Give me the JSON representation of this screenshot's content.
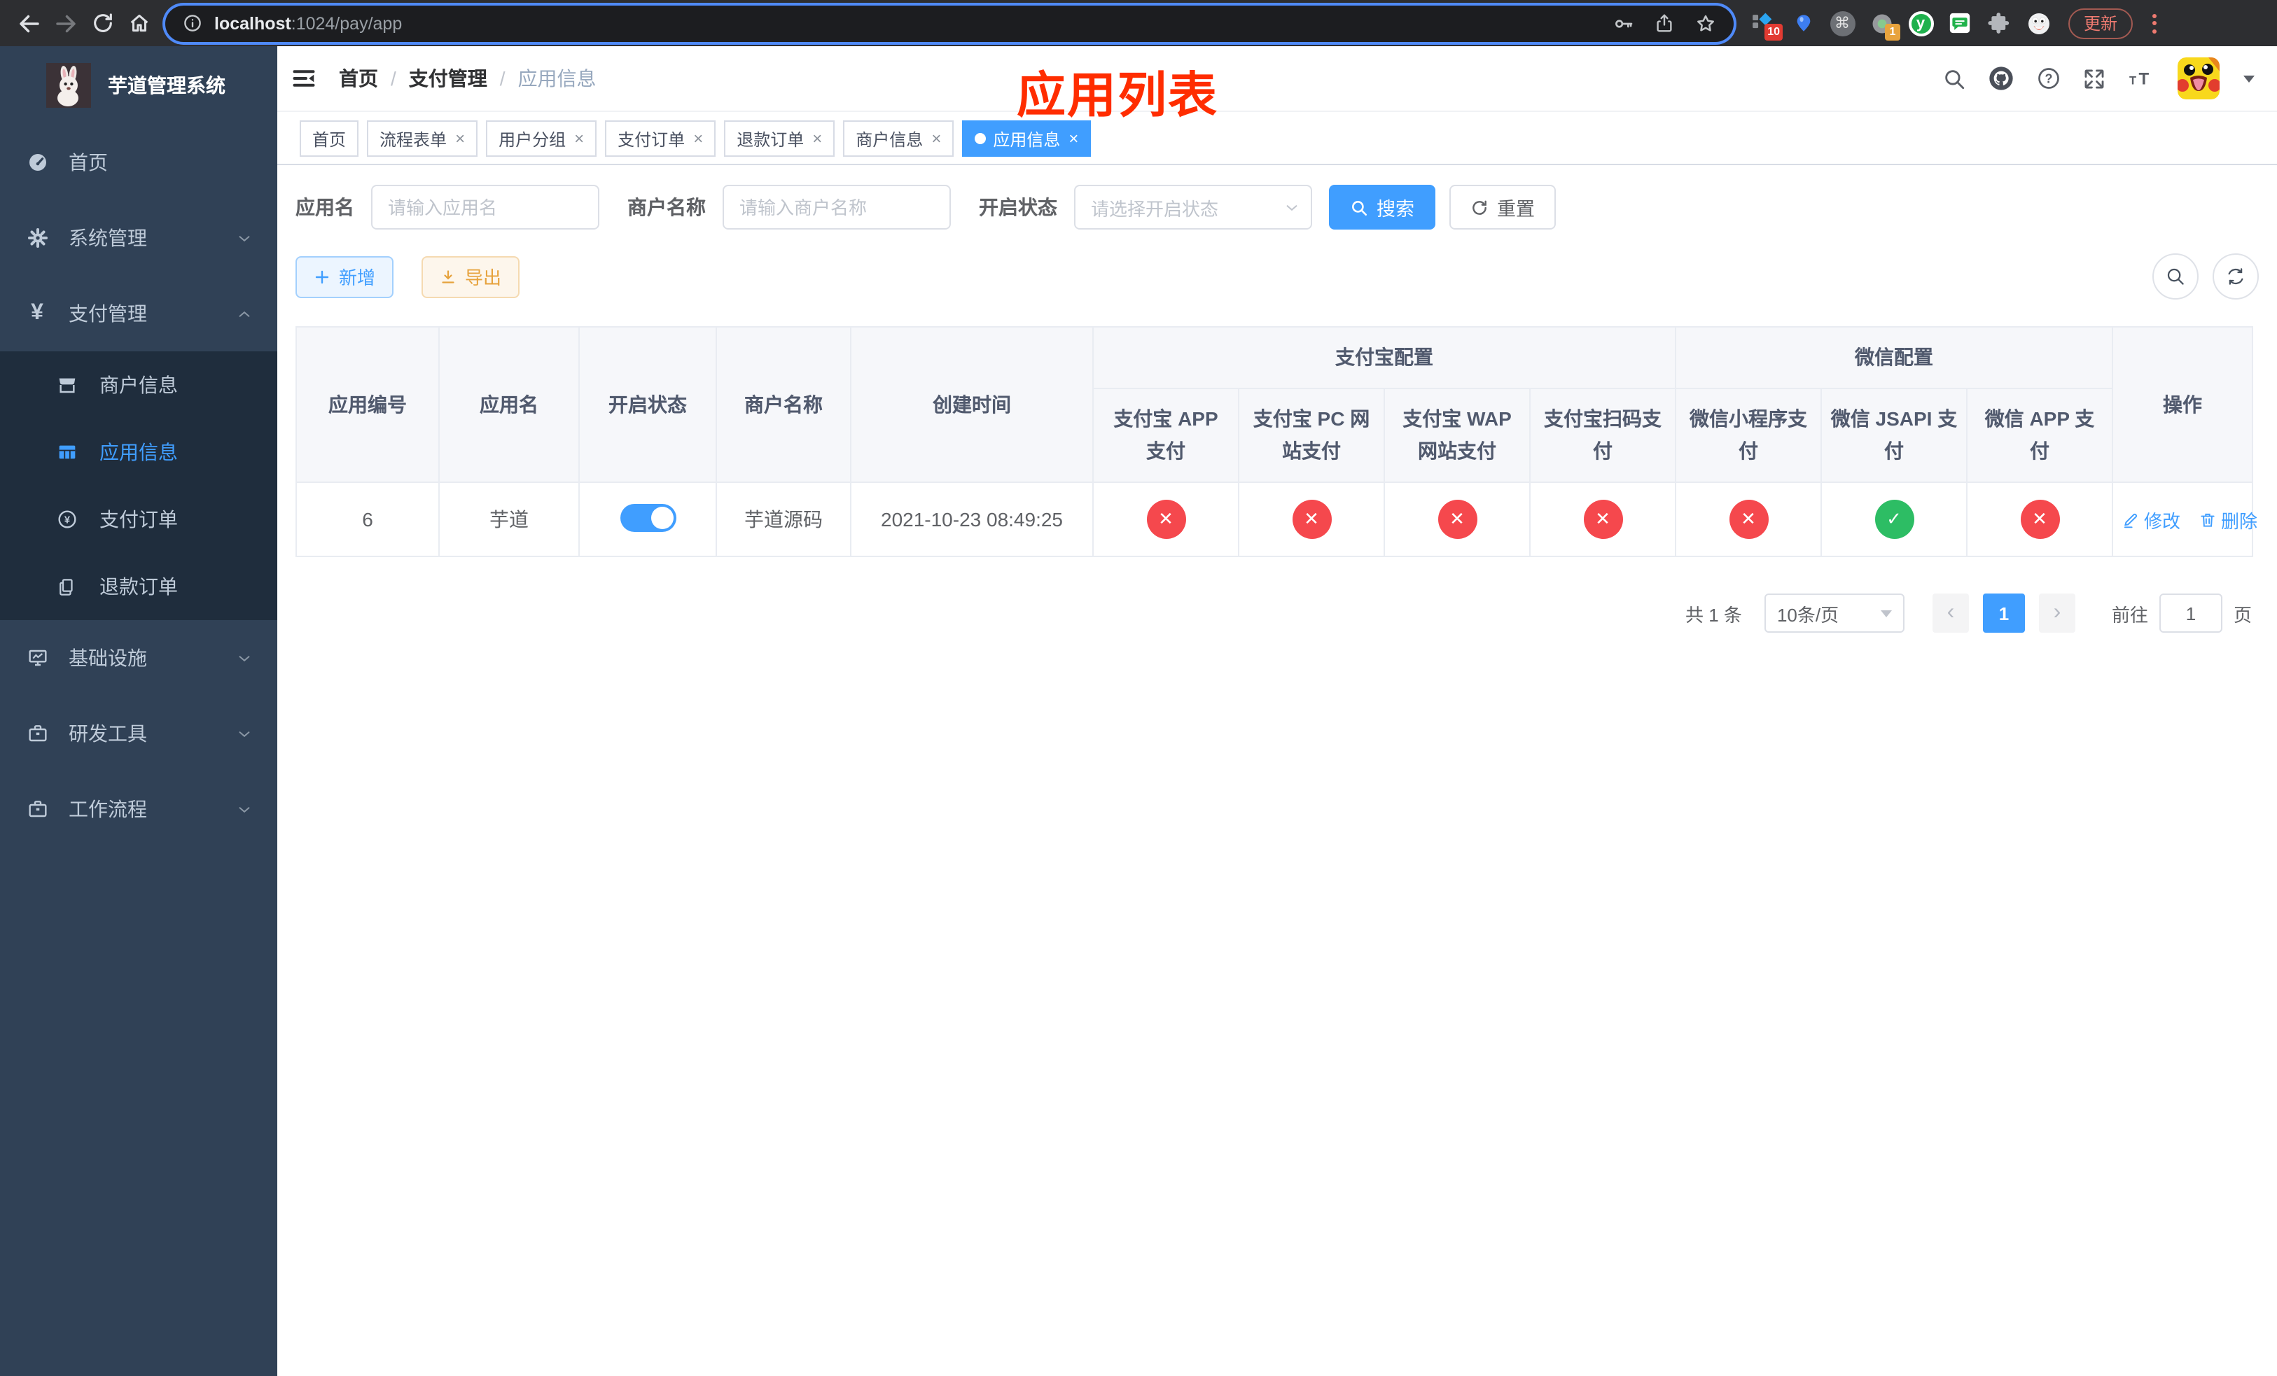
{
  "browser": {
    "url_host": "localhost",
    "url_path": ":1024/pay/app",
    "update_label": "更新",
    "ext_badge_10": "10",
    "ext_badge_1": "1",
    "cmd_glyph": "⌘",
    "y_glyph": "y"
  },
  "sidebar": {
    "logo_title": "芋道管理系统",
    "items": {
      "home": "首页",
      "system": "系统管理",
      "payment": "支付管理",
      "merchant": "商户信息",
      "app": "应用信息",
      "pay_order": "支付订单",
      "refund_order": "退款订单",
      "infra": "基础设施",
      "devtools": "研发工具",
      "workflow": "工作流程"
    }
  },
  "navbar": {
    "breadcrumb": [
      "首页",
      "支付管理",
      "应用信息"
    ],
    "separator": "/"
  },
  "annotation": {
    "text": "应用列表",
    "color": "#ff2d00"
  },
  "tabs": [
    {
      "label": "首页"
    },
    {
      "label": "流程表单"
    },
    {
      "label": "用户分组"
    },
    {
      "label": "支付订单"
    },
    {
      "label": "退款订单"
    },
    {
      "label": "商户信息"
    },
    {
      "label": "应用信息"
    }
  ],
  "ui": {
    "close_glyph": "×",
    "prev_glyph": "‹",
    "next_glyph": "›",
    "check_glyph": "✓",
    "cross_glyph": "✕"
  },
  "filters": {
    "app_name_label": "应用名",
    "app_name_placeholder": "请输入应用名",
    "merchant_label": "商户名称",
    "merchant_placeholder": "请输入商户名称",
    "status_label": "开启状态",
    "status_placeholder": "请选择开启状态",
    "search_label": "搜索",
    "reset_label": "重置"
  },
  "toolbar": {
    "add_label": "新增",
    "export_label": "导出"
  },
  "table": {
    "groups": {
      "alipay": "支付宝配置",
      "wechat": "微信配置"
    },
    "columns": {
      "app_id": "应用编号",
      "app_name": "应用名",
      "status": "开启状态",
      "merchant": "商户名称",
      "created": "创建时间",
      "alipay_app": "支付宝 APP 支付",
      "alipay_pc": "支付宝 PC 网站支付",
      "alipay_wap": "支付宝 WAP 网站支付",
      "alipay_qr": "支付宝扫码支付",
      "wx_lite": "微信小程序支付",
      "wx_jsapi": "微信 JSAPI 支付",
      "wx_app": "微信 APP 支付",
      "actions": "操作"
    },
    "rows": [
      {
        "app_id": "6",
        "app_name": "芋道",
        "enabled": true,
        "merchant": "芋道源码",
        "created": "2021-10-23 08:49:25",
        "pay_status": [
          false,
          false,
          false,
          false,
          false,
          true,
          false
        ],
        "edit_label": "修改",
        "delete_label": "删除"
      }
    ]
  },
  "pagination": {
    "total": "共 1 条",
    "page_size": "10条/页",
    "page": "1",
    "goto_label": "前往",
    "goto_value": "1",
    "unit": "页"
  },
  "colors": {
    "accent": "#409eff",
    "success": "#2dbd64",
    "danger": "#f5484d",
    "warning": "#e6a23c"
  }
}
